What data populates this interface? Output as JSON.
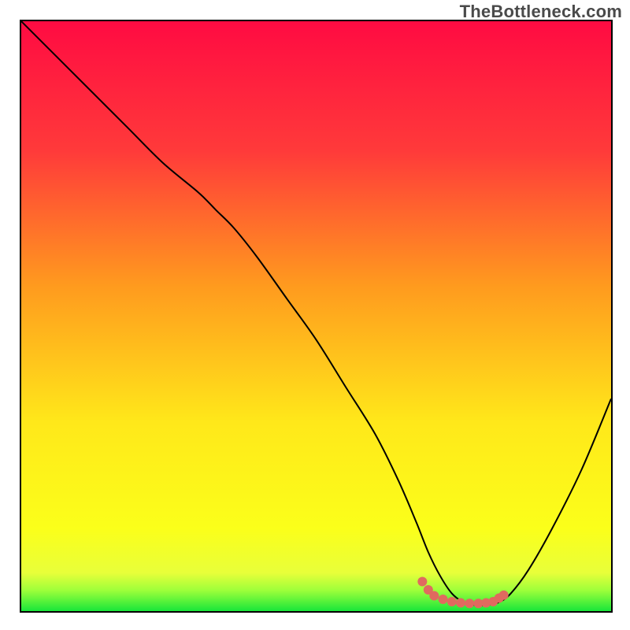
{
  "watermark": "TheBottleneck.com",
  "chart_data": {
    "type": "line",
    "title": "",
    "xlabel": "",
    "ylabel": "",
    "xlim": [
      0,
      100
    ],
    "ylim": [
      0,
      100
    ],
    "grid": false,
    "legend": false,
    "gradient_stops": [
      {
        "pos": 0.0,
        "color": "#ff0b42"
      },
      {
        "pos": 0.22,
        "color": "#ff3a3a"
      },
      {
        "pos": 0.45,
        "color": "#ff9b1e"
      },
      {
        "pos": 0.68,
        "color": "#ffe81a"
      },
      {
        "pos": 0.86,
        "color": "#fbff1a"
      },
      {
        "pos": 0.935,
        "color": "#e8ff3a"
      },
      {
        "pos": 0.965,
        "color": "#9dff3a"
      },
      {
        "pos": 1.0,
        "color": "#18e63a"
      }
    ],
    "series": [
      {
        "name": "bottleneck-curve",
        "color": "#000000",
        "width": 2,
        "x": [
          0,
          6,
          12,
          18,
          24,
          30,
          33,
          36,
          40,
          45,
          50,
          55,
          60,
          64,
          67,
          69,
          71,
          73,
          75,
          77,
          79,
          81,
          83,
          86,
          90,
          95,
          100
        ],
        "y": [
          100,
          94,
          88,
          82,
          76,
          71,
          68,
          65,
          60,
          53,
          46,
          38,
          30,
          22,
          15,
          10,
          6,
          3,
          1.5,
          1,
          1,
          1.5,
          3,
          7,
          14,
          24,
          36
        ]
      },
      {
        "name": "optimal-dots",
        "color": "#e06a5f",
        "render": "dots",
        "radius": 6,
        "x": [
          68.0,
          69.0,
          70.0,
          71.5,
          73.0,
          74.5,
          76.0,
          77.5,
          78.8,
          80.0,
          81.0,
          81.8
        ],
        "y": [
          5.0,
          3.6,
          2.6,
          2.0,
          1.6,
          1.4,
          1.3,
          1.3,
          1.4,
          1.6,
          2.2,
          2.7
        ]
      }
    ]
  }
}
